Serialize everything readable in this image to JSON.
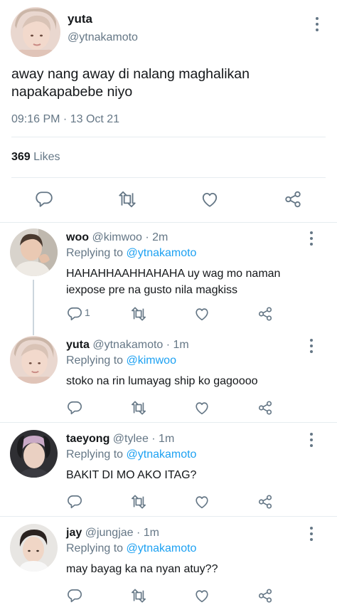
{
  "main": {
    "name": "yuta",
    "handle": "@ytnakamoto",
    "text_line1": "away nang away di nalang maghalikan",
    "text_line2": "napakapabebe niyo",
    "timestamp": "09:16 PM · 13 Oct 21",
    "likes_count": "369",
    "likes_label": "Likes"
  },
  "replies": [
    {
      "name": "woo",
      "handle_time": "@kimwoo · 2m",
      "replying_prefix": "Replying to",
      "replying_to": "@ytnakamoto",
      "text_line1": "HAHAHHAAHHAHAHA uy wag mo naman",
      "text_line2": "iexpose pre na gusto nila magkiss",
      "reply_count": "1"
    },
    {
      "name": "yuta",
      "handle_time": "@ytnakamoto · 1m",
      "replying_prefix": "Replying to",
      "replying_to": "@kimwoo",
      "text_line1": "stoko na rin lumayag ship ko gagoooo"
    },
    {
      "name": "taeyong",
      "handle_time": "@tylee · 1m",
      "replying_prefix": "Replying to",
      "replying_to": "@ytnakamoto",
      "text_line1": "BAKIT DI MO AKO ITAG?"
    },
    {
      "name": "jay",
      "handle_time": "@jungjae · 1m",
      "replying_prefix": "Replying to",
      "replying_to": "@ytnakamoto",
      "text_line1": "may bayag ka na nyan atuy??"
    }
  ],
  "icons": [
    "reply-icon",
    "retweet-icon",
    "like-icon",
    "share-icon",
    "more-icon"
  ],
  "colors": {
    "accent": "#1da1f2",
    "muted": "#657786",
    "text": "#14171a",
    "divider": "#e6ecf0"
  }
}
